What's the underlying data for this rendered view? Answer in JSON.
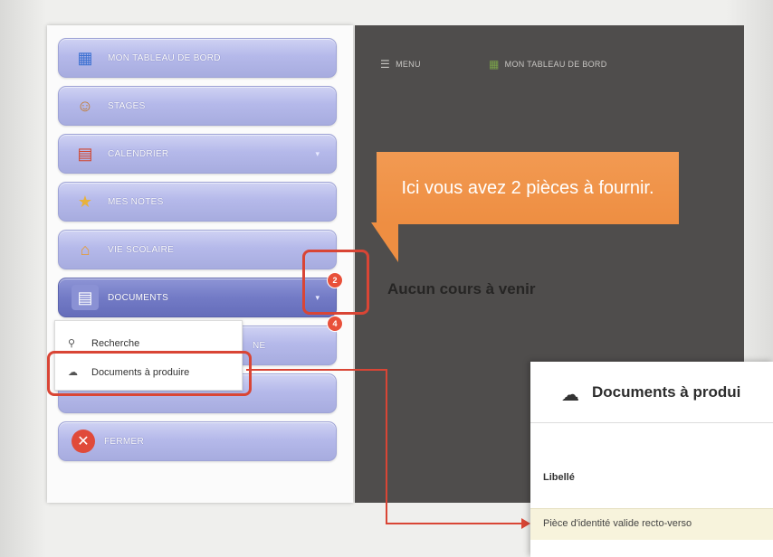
{
  "sidebar": {
    "items": [
      {
        "label": "MON TABLEAU DE BORD",
        "icon": "dashboard-icon"
      },
      {
        "label": "STAGES",
        "icon": "person-icon"
      },
      {
        "label": "CALENDRIER",
        "icon": "calendar-icon",
        "caret": "▾"
      },
      {
        "label": "MES NOTES",
        "icon": "notes-icon"
      },
      {
        "label": "VIE SCOLAIRE",
        "icon": "school-icon"
      },
      {
        "label": "DOCUMENTS",
        "icon": "document-icon",
        "caret": "▾"
      },
      {
        "label": "",
        "icon": "blank-icon"
      },
      {
        "label": "FERMER",
        "icon": "close-icon"
      }
    ],
    "submenu": [
      {
        "label": "Recherche",
        "icon": "search-icon"
      },
      {
        "label": "Documents à produire",
        "icon": "cloud-icon"
      }
    ],
    "partial_text": "NE"
  },
  "topbar": {
    "menu_label": "MENU",
    "dashboard_label": "MON TABLEAU DE BORD"
  },
  "main": {
    "no_course": "Aucun cours à venir"
  },
  "callout": {
    "text": "Ici vous avez 2 pièces à fournir."
  },
  "badges": {
    "count": "2",
    "total": "4"
  },
  "zoom": {
    "title": "Documents à produi",
    "column": "Libellé",
    "row": "Pièce d'identité valide recto-verso"
  },
  "colors": {
    "accent": "#d94535",
    "callout": "#ee8e42",
    "menu": "#b5b9ea"
  }
}
